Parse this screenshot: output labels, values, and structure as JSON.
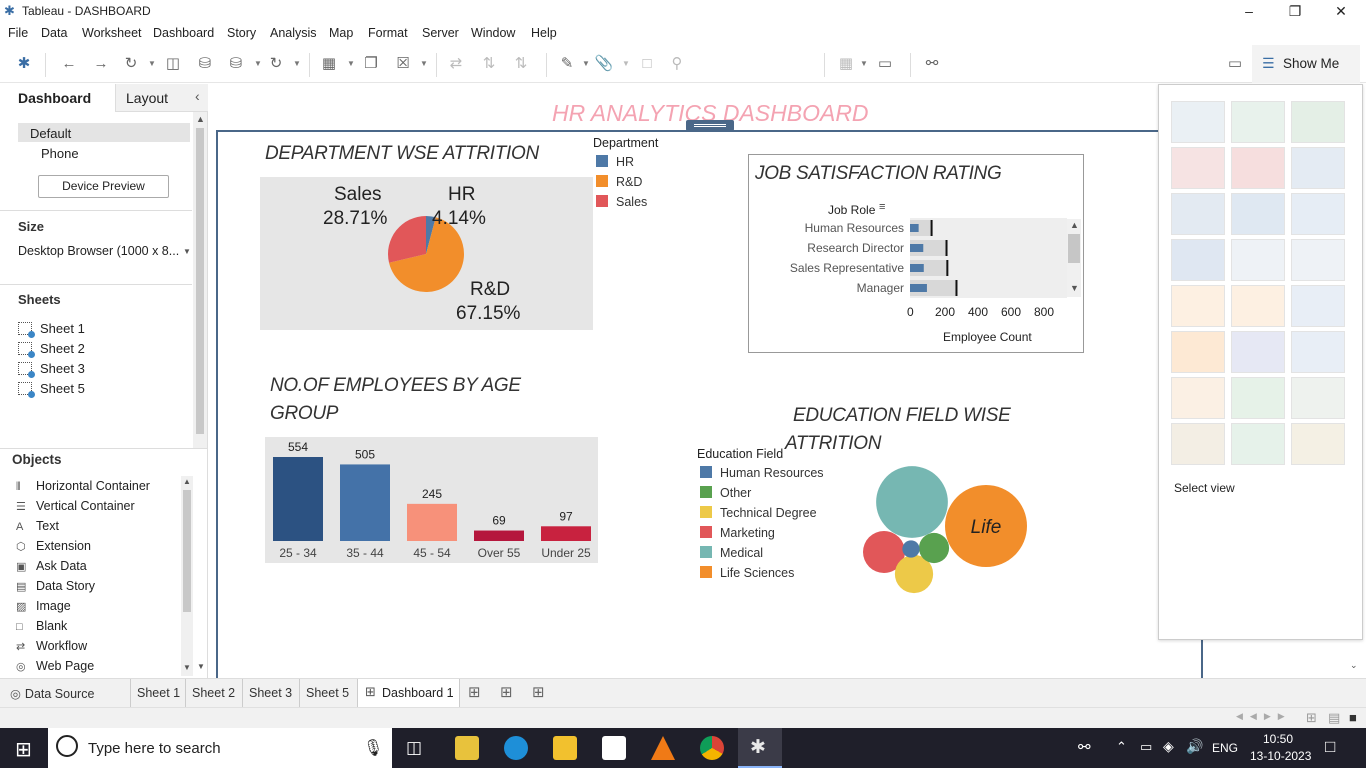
{
  "window": {
    "title": "Tableau - DASHBOARD"
  },
  "menu": [
    "File",
    "Data",
    "Worksheet",
    "Dashboard",
    "Story",
    "Analysis",
    "Map",
    "Format",
    "Server",
    "Window",
    "Help"
  ],
  "toolbar": {
    "show_me": "Show Me"
  },
  "left_panel": {
    "tabs": [
      "Dashboard",
      "Layout"
    ],
    "devices": [
      "Default",
      "Phone"
    ],
    "device_preview": "Device Preview",
    "size_header": "Size",
    "size_value": "Desktop Browser (1000 x 8...",
    "sheets_header": "Sheets",
    "sheets": [
      "Sheet 1",
      "Sheet 2",
      "Sheet 3",
      "Sheet 5"
    ],
    "objects_header": "Objects",
    "objects": [
      {
        "label": "Horizontal Container",
        "icon": "horizontal-container-icon",
        "glyph": "⫴"
      },
      {
        "label": "Vertical Container",
        "icon": "vertical-container-icon",
        "glyph": "☰"
      },
      {
        "label": "Text",
        "icon": "text-icon",
        "glyph": "A"
      },
      {
        "label": "Extension",
        "icon": "extension-icon",
        "glyph": "⬡"
      },
      {
        "label": "Ask Data",
        "icon": "ask-data-icon",
        "glyph": "▣"
      },
      {
        "label": "Data Story",
        "icon": "data-story-icon",
        "glyph": "▤"
      },
      {
        "label": "Image",
        "icon": "image-icon",
        "glyph": "▨"
      },
      {
        "label": "Blank",
        "icon": "blank-icon",
        "glyph": "□"
      },
      {
        "label": "Workflow",
        "icon": "workflow-icon",
        "glyph": "⇄"
      },
      {
        "label": "Web Page",
        "icon": "globe-icon",
        "glyph": "◎"
      }
    ]
  },
  "dashboard": {
    "title": "HR ANALYTICS DASHBOARD",
    "dept": {
      "title": "DEPARTMENT WSE ATTRITION",
      "legend_title": "Department",
      "legend": [
        {
          "name": "HR",
          "color": "#4e79a7"
        },
        {
          "name": "R&D",
          "color": "#f28e2b"
        },
        {
          "name": "Sales",
          "color": "#e15759"
        }
      ],
      "labels": [
        {
          "name": "Sales",
          "pct": "28.71%"
        },
        {
          "name": "HR",
          "pct": "4.14%"
        },
        {
          "name": "R&D",
          "pct": "67.15%"
        }
      ]
    },
    "job": {
      "title": "JOB SATISFACTION RATING",
      "header": "Job Role",
      "roles": [
        "Human Resources",
        "Research Director",
        "Sales Representative",
        "Manager"
      ],
      "axis_ticks": [
        "0",
        "200",
        "400",
        "600",
        "800"
      ],
      "axis_label": "Employee Count"
    },
    "age": {
      "title_line1": "NO.OF EMPLOYEES BY AGE",
      "title_line2": "GROUP"
    },
    "edu": {
      "title_line1": "EDUCATION FIELD WISE",
      "title_line2": "ATTRITION",
      "legend_title": "Education Field",
      "legend": [
        {
          "name": "Human Resources",
          "color": "#4e79a7"
        },
        {
          "name": "Other",
          "color": "#59a14f"
        },
        {
          "name": "Technical Degree",
          "color": "#edc948"
        },
        {
          "name": "Marketing",
          "color": "#e15759"
        },
        {
          "name": "Medical",
          "color": "#76b7b2"
        },
        {
          "name": "Life Sciences",
          "color": "#f28e2b"
        }
      ],
      "bubble_label": "Life"
    }
  },
  "chart_data": [
    {
      "type": "pie",
      "categories": [
        "HR",
        "R&D",
        "Sales"
      ],
      "values": [
        4.14,
        67.15,
        28.71
      ],
      "colors": [
        "#4e79a7",
        "#f28e2b",
        "#e15759"
      ]
    },
    {
      "type": "bar",
      "categories": [
        "25 - 34",
        "35 - 44",
        "45 - 54",
        "Over 55",
        "Under 25"
      ],
      "values": [
        554,
        505,
        245,
        69,
        97
      ],
      "colors": [
        "#2c5282",
        "#4472a8",
        "#f7917a",
        "#b5173d",
        "#c8223f"
      ],
      "ylim": [
        0,
        600
      ]
    },
    {
      "type": "bar",
      "orientation": "horizontal",
      "categories": [
        "Human Resources",
        "Research Director",
        "Sales Representative",
        "Manager"
      ],
      "values": [
        52,
        80,
        83,
        102
      ],
      "reference_values": [
        130,
        220,
        225,
        280
      ],
      "xlim": [
        0,
        1000
      ]
    },
    {
      "type": "bubble",
      "categories": [
        "Life Sciences",
        "Medical",
        "Marketing",
        "Technical Degree",
        "Other",
        "Human Resources"
      ],
      "values": [
        606,
        464,
        159,
        132,
        82,
        27
      ],
      "colors": [
        "#f28e2b",
        "#76b7b2",
        "#e15759",
        "#edc948",
        "#59a14f",
        "#4e79a7"
      ]
    }
  ],
  "sheet_tabs": [
    "Data Source",
    "Sheet 1",
    "Sheet 2",
    "Sheet 3",
    "Sheet 5",
    "Dashboard 1"
  ],
  "showme": {
    "select_view": "Select view"
  },
  "taskbar": {
    "search_placeholder": "Type here to search",
    "lang": "ENG",
    "time": "10:50",
    "date": "13-10-2023"
  }
}
